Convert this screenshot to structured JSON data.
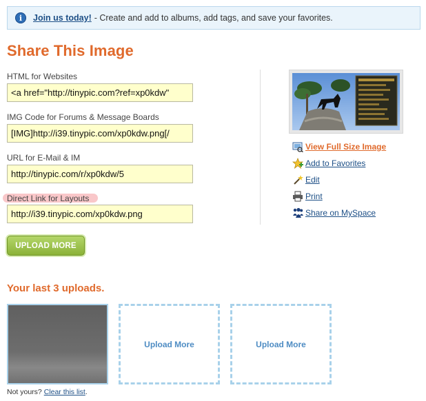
{
  "banner": {
    "link": "Join us today!",
    "text": "- Create and add to albums, add tags, and save your favorites."
  },
  "page_title": "Share This Image",
  "fields": [
    {
      "label": "HTML for Websites",
      "value": "<a href=\"http://tinypic.com?ref=xp0kdw\""
    },
    {
      "label": "IMG Code for Forums & Message Boards",
      "value": "[IMG]http://i39.tinypic.com/xp0kdw.png[/"
    },
    {
      "label": "URL for E-Mail & IM",
      "value": "http://tinypic.com/r/xp0kdw/5"
    },
    {
      "label": "Direct Link for Layouts",
      "value": "http://i39.tinypic.com/xp0kdw.png"
    }
  ],
  "upload_more_button": "UPLOAD MORE",
  "actions": [
    {
      "label": "View Full Size Image",
      "icon": "view-image-icon"
    },
    {
      "label": "Add to Favorites",
      "icon": "add-favorite-icon"
    },
    {
      "label": "Edit",
      "icon": "edit-wand-icon"
    },
    {
      "label": "Print",
      "icon": "printer-icon"
    },
    {
      "label": "Share on MySpace",
      "icon": "myspace-icon"
    }
  ],
  "recent": {
    "title": "Your last 3 uploads.",
    "slots": [
      "Upload More",
      "Upload More"
    ],
    "footer_prefix": "Not yours?",
    "footer_link": "Clear this list",
    "footer_suffix": "."
  },
  "colors": {
    "accent": "#e06a2c",
    "link": "#1d4f86",
    "input_bg": "#ffffcc",
    "banner_bg": "#eaf4fb",
    "button_green": "#8bb238",
    "dashed_border": "#a8d1ea"
  }
}
